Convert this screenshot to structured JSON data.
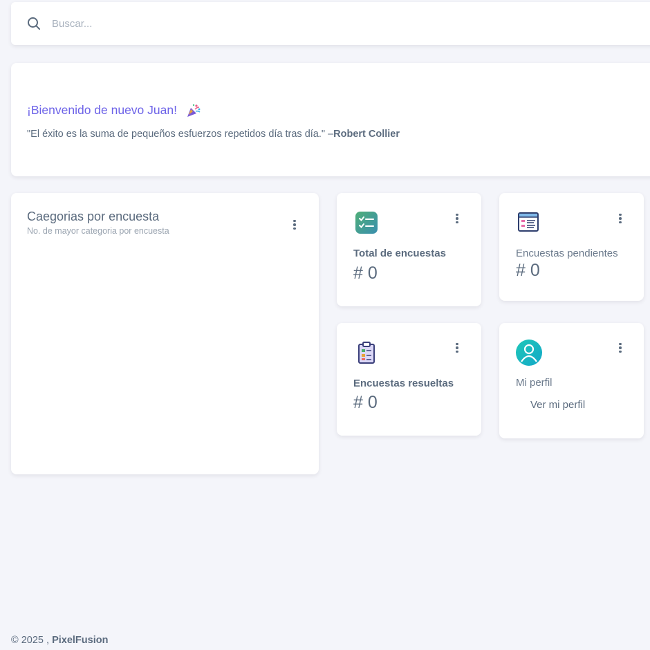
{
  "search": {
    "placeholder": "Buscar..."
  },
  "welcome": {
    "title": "¡Bienvenido de nuevo Juan!",
    "quote": "\"El éxito es la suma de pequeños esfuerzos repetidos día tras día.\" –",
    "author": "Robert Collier"
  },
  "category_chart": {
    "title": "Caegorias por encuesta",
    "subtitle": "No. de mayor categoria por encuesta"
  },
  "stats": {
    "total": {
      "label": "Total de encuestas",
      "value": "# 0",
      "icon": "checklist-icon"
    },
    "pending": {
      "label": "Encuestas pendientes",
      "value": "# 0",
      "icon": "browser-list-icon"
    },
    "resolved": {
      "label": "Encuestas resueltas",
      "value": "# 0",
      "icon": "clipboard-icon"
    }
  },
  "profile": {
    "label": "Mi perfil",
    "link": "Ver mi perfil",
    "icon": "user-icon"
  },
  "footer": {
    "copyright": "© 2025 , ",
    "brand": "PixelFusion"
  },
  "colors": {
    "accent": "#6d63e8",
    "background": "#f4f5fa",
    "text": "#5b6b7e"
  }
}
